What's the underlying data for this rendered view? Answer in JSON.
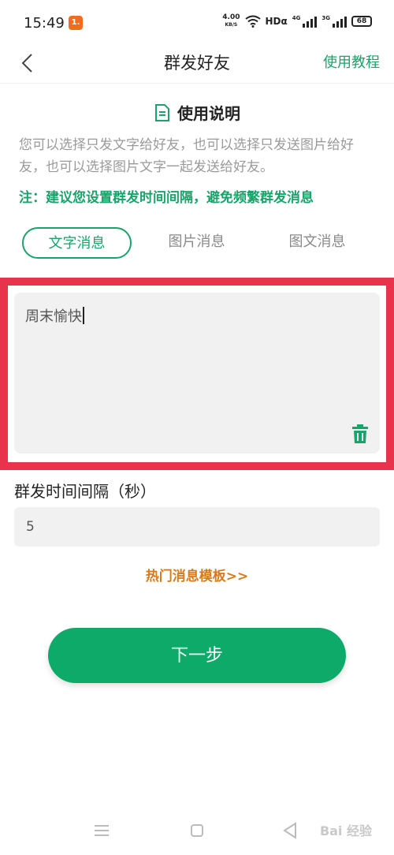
{
  "status_bar": {
    "time": "15:49",
    "app_badge": "1.",
    "net_speed_value": "4.00",
    "net_speed_unit": "KB/S",
    "hd_label": "HDα",
    "signal_1_label": "4G",
    "signal_2_label": "3G",
    "battery": "68"
  },
  "header": {
    "title": "群发好友",
    "tutorial_link": "使用教程"
  },
  "usage": {
    "title": "使用说明",
    "description": "您可以选择只发文字给好友，也可以选择只发送图片给好友，也可以选择图片文字一起发送给好友。",
    "note": "注：建议您设置群发时间间隔，避免频繁群发消息"
  },
  "tabs": [
    {
      "label": "文字消息",
      "active": true
    },
    {
      "label": "图片消息",
      "active": false
    },
    {
      "label": "图文消息",
      "active": false
    }
  ],
  "message": {
    "value": "周末愉快"
  },
  "interval": {
    "label": "群发时间间隔（秒）",
    "value": "5"
  },
  "template_link": "热门消息模板>>",
  "next_button": "下一步",
  "watermark": "Bai 经验",
  "icons": {
    "back": "back-chevron-icon",
    "doc": "document-icon",
    "trash": "trash-icon",
    "nav_menu": "menu-icon",
    "nav_home": "home-square-icon",
    "nav_back": "back-triangle-icon"
  },
  "colors": {
    "accent_green": "#1aa36a",
    "button_green": "#0eaa6a",
    "highlight_red": "#e8334c",
    "link_orange": "#d87a19"
  }
}
